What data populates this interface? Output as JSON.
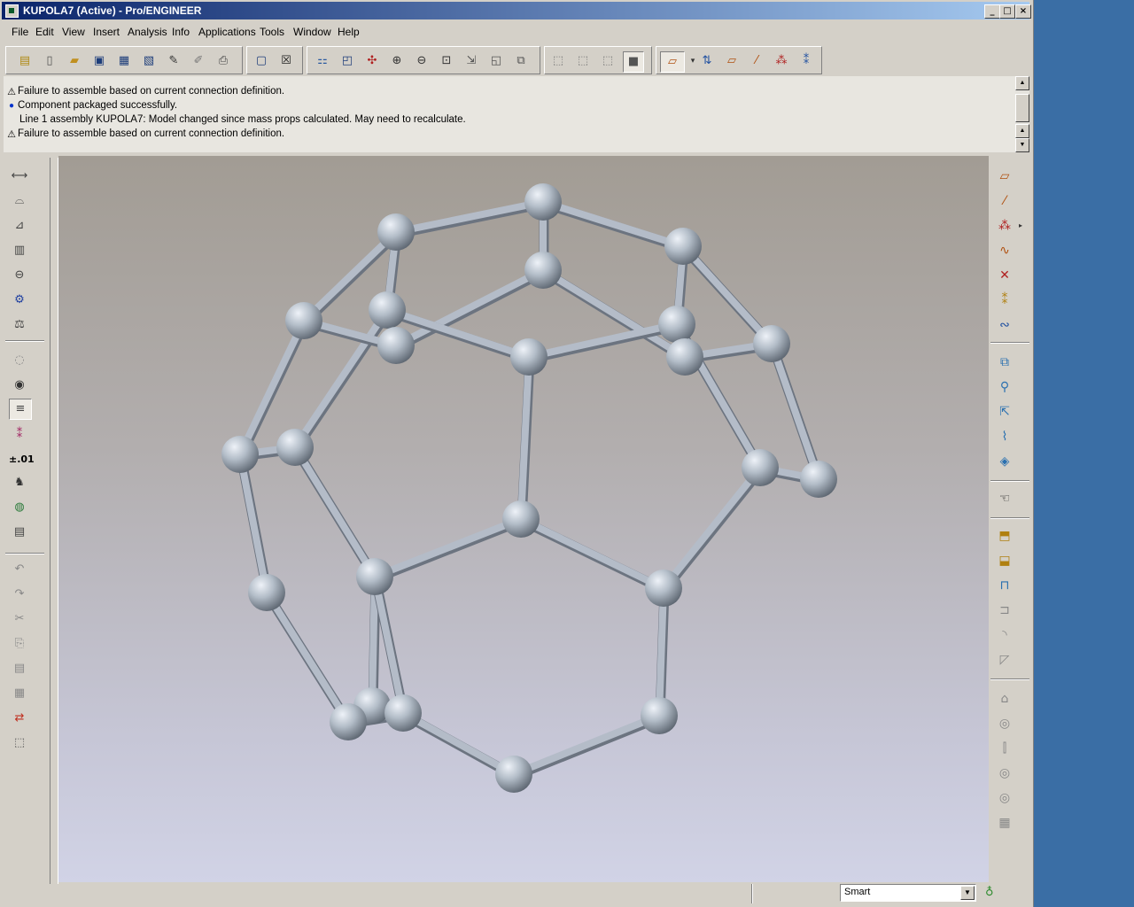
{
  "window": {
    "title": "KUPOLA7 (Active) - Pro/ENGINEER",
    "controls": {
      "minimize": "_",
      "maximize": "□",
      "close": "×"
    }
  },
  "menu": [
    "File",
    "Edit",
    "View",
    "Insert",
    "Analysis",
    "Info",
    "Applications",
    "Tools",
    "Window",
    "Help"
  ],
  "toolbar": {
    "icons": [
      "open-dir-icon",
      "new-file-icon",
      "open-file-icon",
      "save-icon",
      "save-copy-icon",
      "backup-icon",
      "rename-icon",
      "erase-icon",
      "print-icon",
      "window-activate-icon",
      "window-close-icon",
      "regenerate-icon",
      "named-view-icon",
      "spin-center-icon",
      "zoom-in-icon",
      "zoom-out-icon",
      "refit-icon",
      "orient-icon",
      "layers-icon",
      "reference-icon",
      "wireframe-icon",
      "hidden-line-icon",
      "no-hidden-icon",
      "shaded-icon",
      "datum-plane-display-icon",
      "datum-axis-display-icon",
      "datum-point-display-icon",
      "coord-sys-display-icon",
      "spin-icon"
    ],
    "shaded_pressed": true
  },
  "messages": [
    {
      "type": "warning",
      "text": "Failure to assemble based on current connection definition."
    },
    {
      "type": "info",
      "text": "Component packaged successfully."
    },
    {
      "type": "plain",
      "text": "Line 1 assembly KUPOLA7: Model changed since mass props calculated. May need to recalculate."
    },
    {
      "type": "warning",
      "text": "Failure to assemble based on current connection definition."
    }
  ],
  "left_toolbar": {
    "tolerance_label": "±.01"
  },
  "status": {
    "filter_value": "Smart"
  }
}
